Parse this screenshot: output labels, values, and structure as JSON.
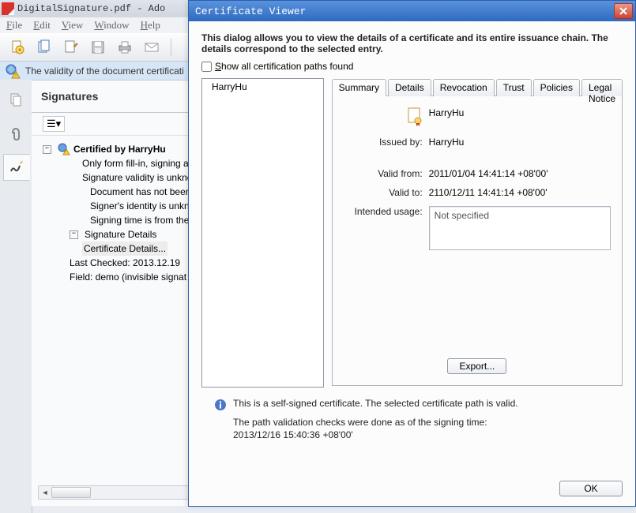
{
  "adobe": {
    "title": "DigitalSignature.pdf - Ado",
    "menus": [
      "File",
      "Edit",
      "View",
      "Window",
      "Help"
    ],
    "validity_text": "The validity of the document certificati",
    "sig_title": "Signatures",
    "opts_label": "☰▾",
    "tree": {
      "certified_by": "Certified by HarryHu",
      "l1": "Only form fill-in, signing and",
      "l2": "Signature validity is unknow",
      "l3": "Document has not been",
      "l4": "Signer's identity is unkn",
      "l5": "Signing time is from the",
      "sig_details": "Signature Details",
      "cert_details": "Certificate Details...",
      "last_checked": "Last Checked: 2013.12.19",
      "field": "Field: demo (invisible signat"
    }
  },
  "dialog": {
    "title": "Certificate Viewer",
    "intro": "This dialog allows you to view the details of a certificate and its entire issuance chain. The details correspond to the selected entry.",
    "show_all": "Show all certification paths found",
    "list_item": "HarryHu",
    "tabs": [
      "Summary",
      "Details",
      "Revocation",
      "Trust",
      "Policies",
      "Legal Notice"
    ],
    "subject": "HarryHu",
    "issued_by_lbl": "Issued by:",
    "issued_by": "HarryHu",
    "valid_from_lbl": "Valid from:",
    "valid_from": "2011/01/04 14:41:14 +08'00'",
    "valid_to_lbl": "Valid to:",
    "valid_to": "2110/12/11 14:41:14 +08'00'",
    "intended_lbl": "Intended usage:",
    "intended": "Not specified",
    "export": "Export...",
    "footer_line1": "This is a self-signed certificate. The selected certificate path is valid.",
    "footer_line2a": "The path validation checks were done as of the signing time:",
    "footer_line2b": "2013/12/16 15:40:36 +08'00'",
    "ok": "OK"
  }
}
